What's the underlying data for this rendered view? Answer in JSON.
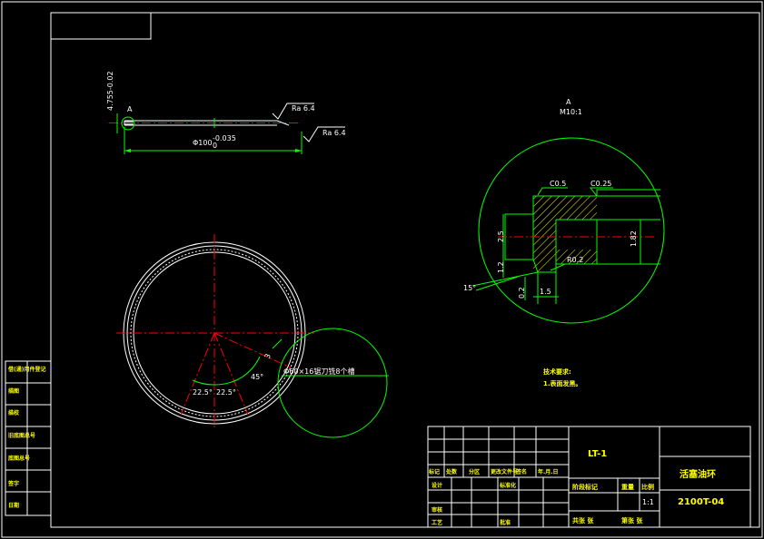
{
  "detail": {
    "label": "A",
    "scale": "M10:1",
    "chamfer_1": "C0.5",
    "chamfer_2": "C0.25",
    "dim_25": "2.5",
    "dim_182": "1.82",
    "dim_12": "1.2",
    "dim_02": "0.2",
    "dim_15": "1.5",
    "radius": "R0.2",
    "angle": "15°"
  },
  "profile": {
    "marker": "A",
    "thickness_dim": "4.755-0.02",
    "thickness_tol": "0",
    "diameter_dim": "Φ100",
    "diameter_tol_upper": "-0.035",
    "diameter_tol_lower": "0",
    "roughness_1": "Ra 6.4",
    "roughness_2": "Ra 6.4"
  },
  "plan": {
    "angle_45": "45°",
    "angle_a": "22.5°",
    "angle_b": "22.5°",
    "dim_3": "3",
    "cutter_note": "Φ60×16锯刀铣8个槽"
  },
  "notes": {
    "heading": "技术要求:",
    "item_1": "1.表面发黑。"
  },
  "title_block": {
    "drawing_no": "LT-1",
    "part_name": "活塞油环",
    "code": "2100T-04",
    "scale": "1:1",
    "marks_label": "阶段标记",
    "weight_label": "重量",
    "scale_label": "比例",
    "sheets_total": "共张  张",
    "sheet_no": "第张  张",
    "rev_row": [
      "标记",
      "处数",
      "分区",
      "更改文件号",
      "签名",
      "年.月.日"
    ],
    "design": "设计",
    "standardize": "标准化",
    "review": "审核",
    "process": "工艺",
    "approve": "批准"
  },
  "side_strip": [
    "借(通)用件登记",
    "描图",
    "描校",
    "旧底图总号",
    "底图总号",
    "签字",
    "日期"
  ]
}
